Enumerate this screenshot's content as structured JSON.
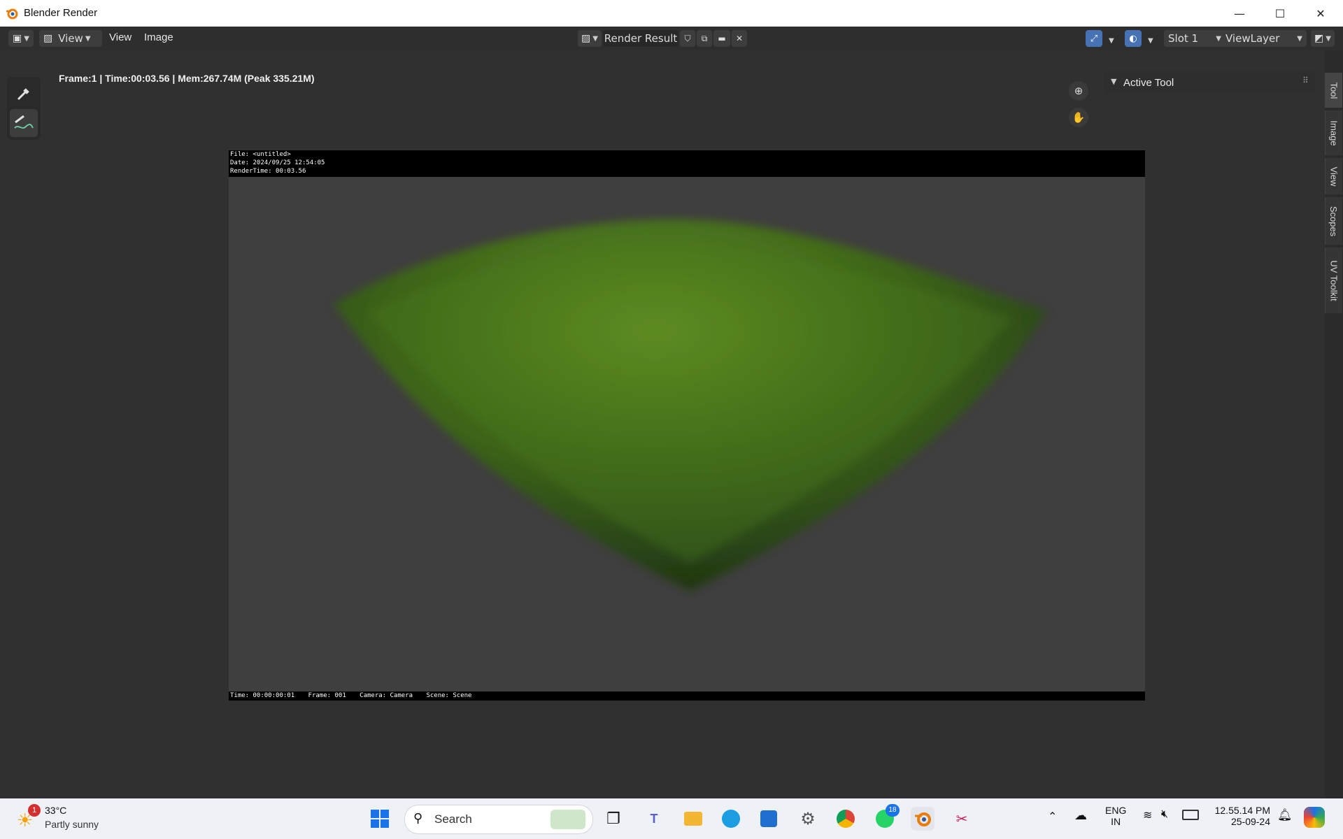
{
  "window": {
    "title": "Blender Render",
    "minimize": "—",
    "maximize": "☐",
    "close": "✕"
  },
  "header": {
    "menus": [
      "View",
      "View",
      "Image"
    ],
    "image_name": "Render Result",
    "slot": "Slot 1",
    "view_layer": "ViewLayer"
  },
  "status": {
    "stats": "Frame:1 | Time:00:03.56 | Mem:267.74M (Peak 335.21M)"
  },
  "render": {
    "stamp_top": [
      "File: <untitled>",
      "Date: 2024/09/25 12:54:05",
      "RenderTime: 00:03.56"
    ],
    "stamp_bottom": [
      "Time: 00:00:00:01",
      "Frame: 001",
      "Camera: Camera",
      "Scene: Scene"
    ]
  },
  "sidebar": {
    "panel_title": "Active Tool",
    "tabs": [
      "Tool",
      "Image",
      "View",
      "Scopes",
      "UV Toolkit"
    ]
  },
  "taskbar": {
    "weather_temp": "33°C",
    "weather_desc": "Partly sunny",
    "weather_badge": "1",
    "search_placeholder": "Search",
    "whatsapp_badge": "18",
    "lang_top": "ENG",
    "lang_bottom": "IN",
    "time": "12.55.14 PM",
    "date": "25-09-24"
  },
  "colors": {
    "accent": "#4772b3",
    "blender_orange": "#e87d0d",
    "grass": "#4a7a1c"
  }
}
